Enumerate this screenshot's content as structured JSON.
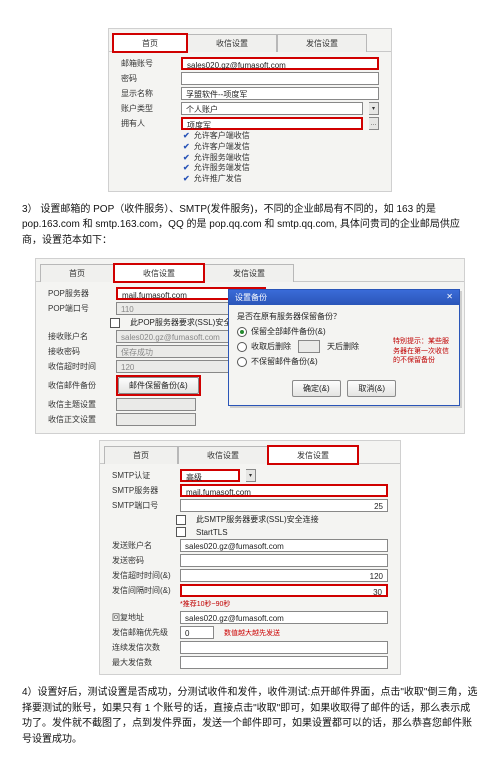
{
  "panel1": {
    "tabs": {
      "t1": "首页",
      "t2": "收信设置",
      "t3": "发信设置"
    },
    "rows": {
      "account_label": "邮箱账号",
      "account_value": "sales020.gz@fumasoft.com",
      "pwd_label": "密码",
      "display_label": "显示名称",
      "display_value": "孚盟软件--项度军",
      "type_label": "账户类型",
      "type_value": "个人账户",
      "assign_label": "拥有人",
      "assign_value": "项度军"
    },
    "checks": {
      "c1": "允许客户端收信",
      "c2": "允许客户端发信",
      "c3": "允许服务端收信",
      "c4": "允许服务端发信",
      "c5": "允许推广发信"
    }
  },
  "para1_pre": "3） 设置邮箱的 POP（收件服务）、SMTP(发件服务)，不同的企业邮局有不同的，如 163 的是 pop.163.com 和 smtp.163.com，QQ 的是 pop.qq.com 和 smtp.qq.com, 具体问贵司的企业邮局供应商，设置范本如下：",
  "panel2": {
    "tabs": {
      "t1": "首页",
      "t2": "收信设置",
      "t3": "发信设置"
    },
    "rows": {
      "pop_label": "POP服务器",
      "pop_value": "mail.fumasoft.com",
      "popport_label": "POP端口号",
      "popport_value": "110",
      "ssl_label": "此POP服务器要求(SSL)安全连接",
      "recv_acc_label": "接收账户名",
      "recv_acc_value": "sales020.gz@fumasoft.com",
      "recv_pwd_label": "接收密码",
      "recv_pwd_value": "保存成功",
      "timeout_label": "收信超时时间",
      "timeout_value": "120",
      "bak_label": "收信邮件备份",
      "bak_btn": "邮件保留备份(&)",
      "subj_label": "收信主题设置",
      "subj2_label": "收信正文设置"
    },
    "dialog": {
      "title": "设置备份",
      "q": "是否在原有服务器保留备份？",
      "r1": "保留全部邮件备份(&)",
      "r2": "收取后删除",
      "r2b": "天后删除",
      "r3": "不保留邮件备份(&)",
      "warn": "特别提示：某些服务器在第一次收信的不保留备份",
      "ok": "确定(&)",
      "cancel": "取消(&)"
    }
  },
  "panel3": {
    "tabs": {
      "t1": "首页",
      "t2": "收信设置",
      "t3": "发信设置"
    },
    "rows": {
      "auth_label": "SMTP认证",
      "auth_value": "高级",
      "smtp_label": "SMTP服务器",
      "smtp_value": "mail.fumasoft.com",
      "port_label": "SMTP端口号",
      "port_value": "25",
      "ssl": "此SMTP服务器要求(SSL)安全连接",
      "starttls": "StartTLS",
      "send_acc_label": "发送账户名",
      "send_acc_value": "sales020.gz@fumasoft.com",
      "send_pwd_label": "发送密码",
      "timeout_label": "发信超时时间(&)",
      "timeout_value": "120",
      "interval_label": "发信间隔时间(&)",
      "interval_value": "30",
      "interval_tip": "*推荐10秒~90秒",
      "reply_label": "回复地址",
      "reply_value": "sales020.gz@fumasoft.com",
      "pri_label": "发信邮箱优先级",
      "pri_value": "0",
      "pri_tip": "数值越大越先发送",
      "count_label": "连续发信次数",
      "count2_label": "最大发信数"
    }
  },
  "para2": "4）设置好后，测试设置是否成功，分测试收件和发件，收件测试:点开邮件界面，点击\"收取\"倒三角，选择要测试的账号，如果只有 1 个账号的话，直接点击\"收取\"即可，如果收取得了邮件的话，那么表示成功了。发件就不截图了，点到发件界面，发送一个邮件即可，如果设置都可以的话，那么恭喜您邮件账号设置成功。"
}
